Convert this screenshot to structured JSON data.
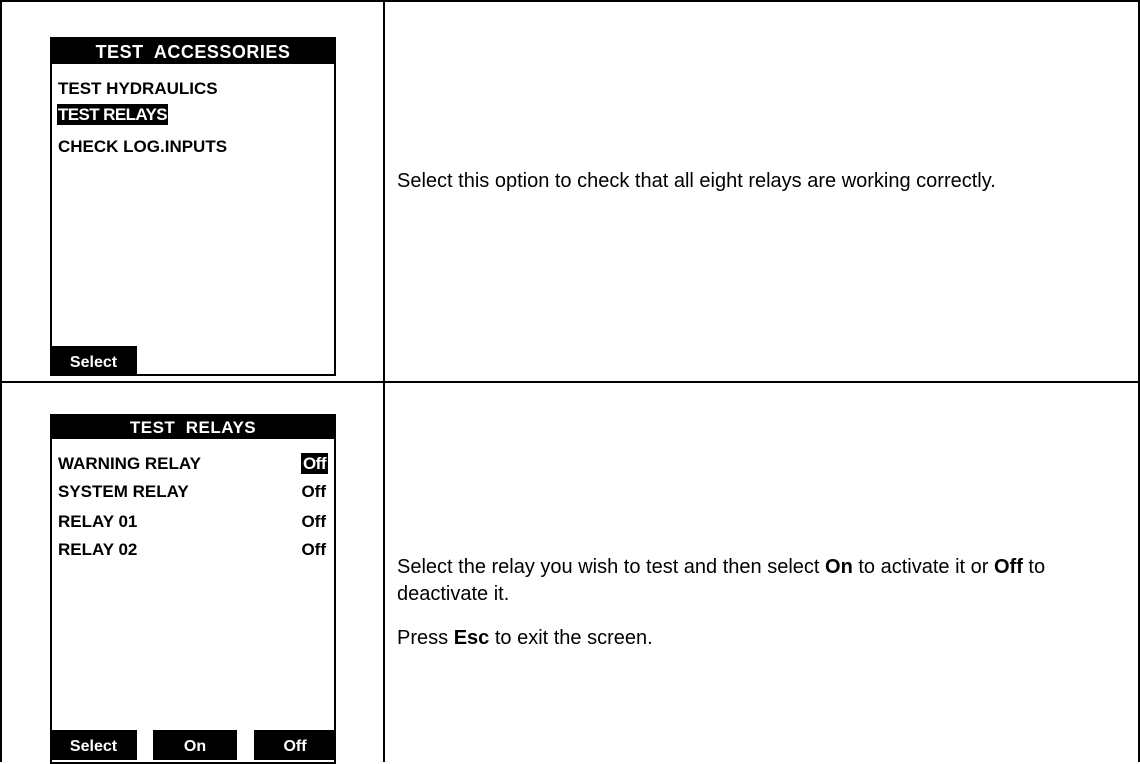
{
  "rows": [
    {
      "screen": {
        "title": "TEST  ACCESSORIES",
        "items": [
          {
            "label": "TEST HYDRAULICS",
            "selected": false
          },
          {
            "label": "TEST RELAYS",
            "selected": true
          },
          {
            "label": "CHECK LOG.INPUTS",
            "selected": false
          }
        ],
        "soft_keys": [
          "Select"
        ]
      },
      "description": [
        "Select this option to check that all eight relays are working correctly."
      ]
    },
    {
      "screen": {
        "title": "TEST  RELAYS",
        "relays": [
          {
            "name": "WARNING RELAY",
            "value": "Off",
            "selected": true
          },
          {
            "name": "SYSTEM RELAY",
            "value": "Off",
            "selected": false
          },
          {
            "name": "RELAY 01",
            "value": "Off",
            "selected": false
          },
          {
            "name": "RELAY 02",
            "value": "Off",
            "selected": false
          }
        ],
        "soft_keys": [
          "Select",
          "On",
          "Off"
        ]
      },
      "description": [
        {
          "parts": [
            "Select the relay you wish to test and then select ",
            "On",
            " to activate it or ",
            "Off",
            " to deactivate it."
          ]
        },
        {
          "parts": [
            "Press ",
            "Esc",
            " to exit the screen."
          ]
        }
      ]
    }
  ]
}
